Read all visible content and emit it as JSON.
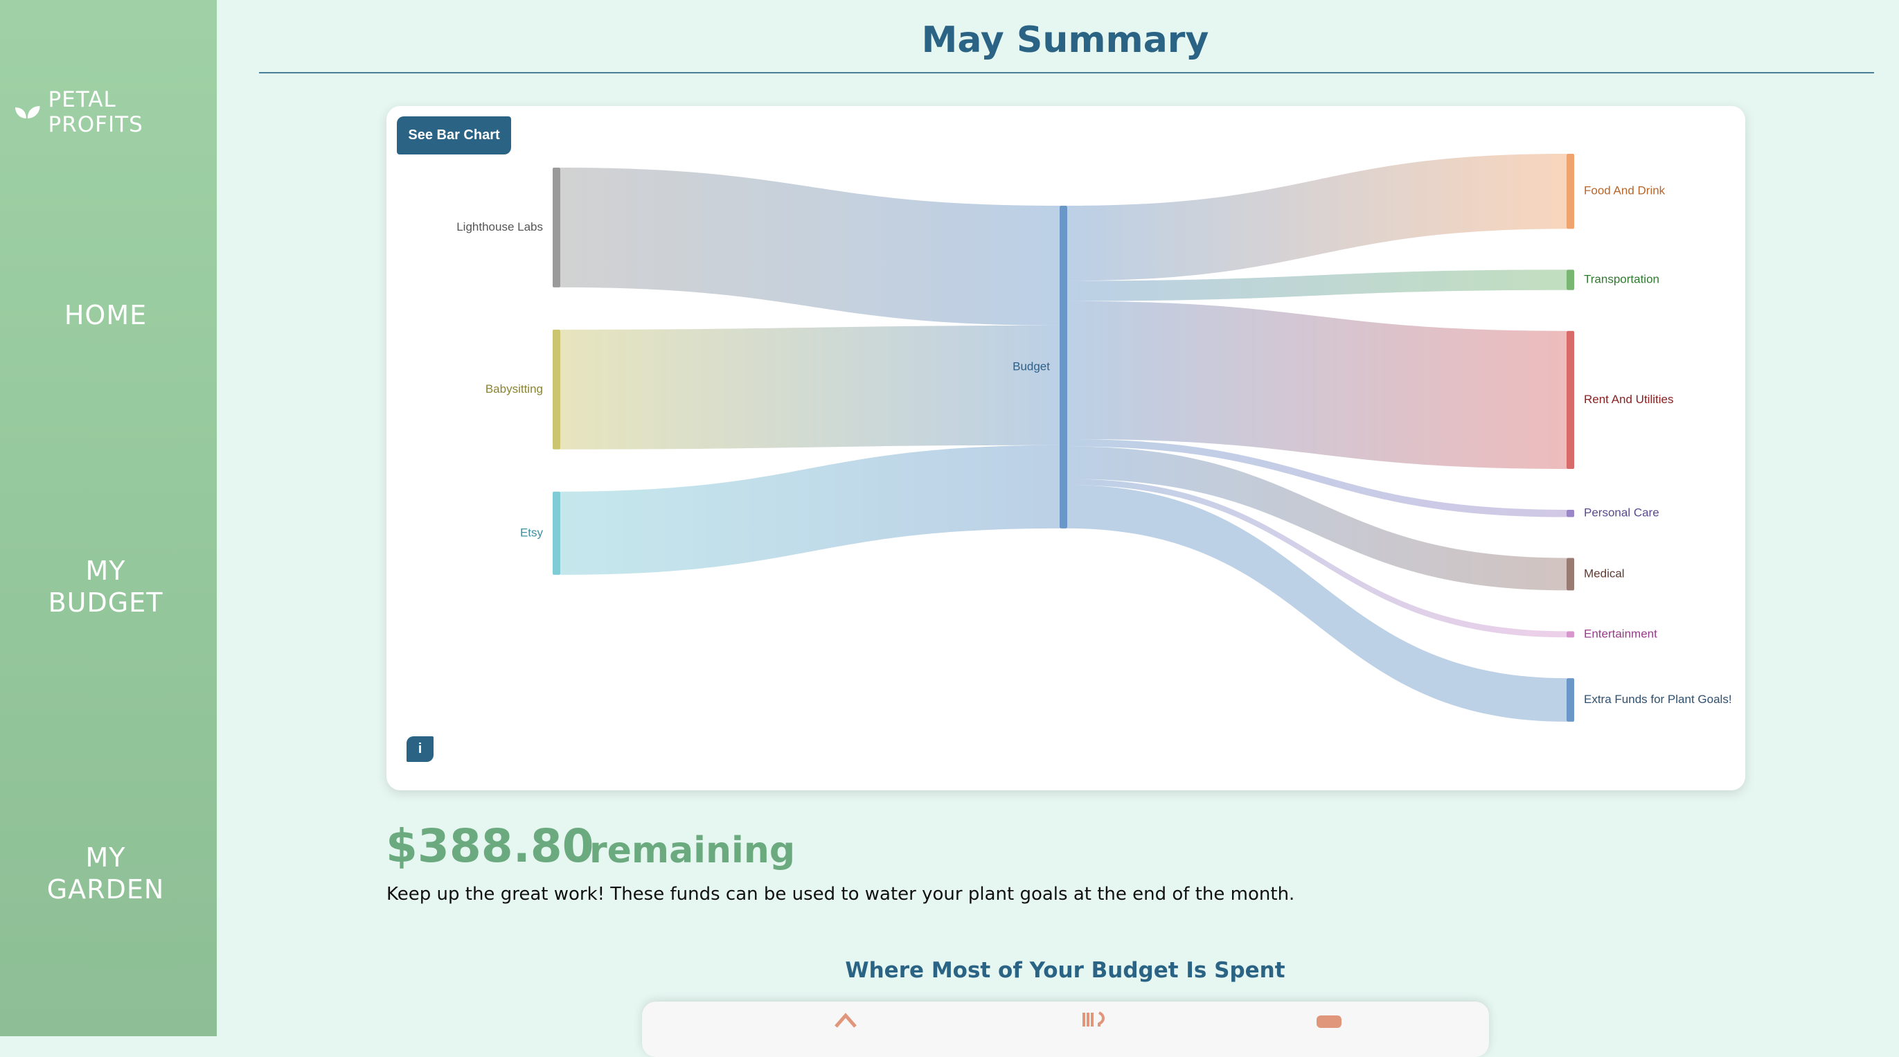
{
  "brand": {
    "name": "PETAL PROFITS",
    "icon": "leaf-icon"
  },
  "nav": [
    {
      "lines": [
        "HOME"
      ]
    },
    {
      "lines": [
        "MY",
        "BUDGET"
      ]
    },
    {
      "lines": [
        "MY",
        "GARDEN"
      ]
    }
  ],
  "page": {
    "title": "May Summary"
  },
  "chart_controls": {
    "toggle_label": "See Bar Chart",
    "info_label": "i"
  },
  "chart_data": {
    "type": "sankey",
    "nodes": [
      {
        "name": "Lighthouse Labs",
        "column": 0,
        "value": 29.5,
        "color": "#9a9a9a"
      },
      {
        "name": "Babysitting",
        "column": 0,
        "value": 29.5,
        "color": "#cbc56f"
      },
      {
        "name": "Etsy",
        "column": 0,
        "value": 20.5,
        "color": "#7fcbd6"
      },
      {
        "name": "Budget",
        "column": 1,
        "value": 79.5,
        "color": "#6a97c8"
      },
      {
        "name": "Food And Drink",
        "column": 2,
        "value": 18.5,
        "color": "#f0a36c"
      },
      {
        "name": "Transportation",
        "column": 2,
        "value": 5,
        "color": "#78b672"
      },
      {
        "name": "Rent And Utilities",
        "column": 2,
        "value": 34,
        "color": "#d86a6a"
      },
      {
        "name": "Personal Care",
        "column": 2,
        "value": 1.8,
        "color": "#9a86c6"
      },
      {
        "name": "Medical",
        "column": 2,
        "value": 8,
        "color": "#9a7b74"
      },
      {
        "name": "Entertainment",
        "column": 2,
        "value": 1.5,
        "color": "#d896cf"
      },
      {
        "name": "Extra Funds for Plant Goals!",
        "column": 2,
        "value": 10.7,
        "color": "#6a97c8"
      }
    ],
    "links": [
      {
        "source": "Lighthouse Labs",
        "target": "Budget",
        "value": 29.5
      },
      {
        "source": "Babysitting",
        "target": "Budget",
        "value": 29.5
      },
      {
        "source": "Etsy",
        "target": "Budget",
        "value": 20.5
      },
      {
        "source": "Budget",
        "target": "Food And Drink",
        "value": 18.5
      },
      {
        "source": "Budget",
        "target": "Transportation",
        "value": 5
      },
      {
        "source": "Budget",
        "target": "Rent And Utilities",
        "value": 34
      },
      {
        "source": "Budget",
        "target": "Personal Care",
        "value": 1.8
      },
      {
        "source": "Budget",
        "target": "Medical",
        "value": 8
      },
      {
        "source": "Budget",
        "target": "Entertainment",
        "value": 1.5
      },
      {
        "source": "Budget",
        "target": "Extra Funds for Plant Goals!",
        "value": 10.7
      }
    ],
    "label_colors": {
      "Lighthouse Labs": "#555555",
      "Babysitting": "#8a8430",
      "Etsy": "#3f8fa0",
      "Budget": "#2e5f88",
      "Food And Drink": "#b8652a",
      "Transportation": "#2e7a2e",
      "Rent And Utilities": "#8a2020",
      "Personal Care": "#5a4a8a",
      "Medical": "#5e3a30",
      "Entertainment": "#9a3a8a",
      "Extra Funds for Plant Goals!": "#2e5070"
    }
  },
  "summary": {
    "amount": "$388.80",
    "amount_suffix": "remaining",
    "message": "Keep up the great work! These funds can be used to water your plant goals at the end of the month."
  },
  "section": {
    "heading": "Where Most of Your Budget Is Spent"
  },
  "bottom_icons": [
    "house-icon",
    "fork-knife-icon",
    "medical-icon"
  ],
  "colors": {
    "primary": "#2a6384",
    "accent_green": "#6aaa7e",
    "background": "#e6f6f1"
  }
}
